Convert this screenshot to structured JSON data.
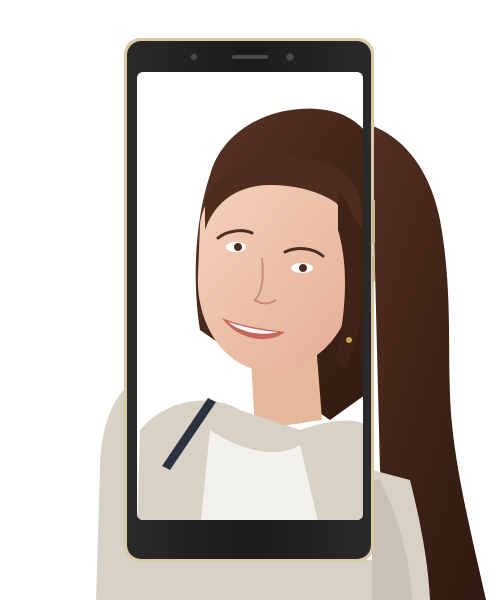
{
  "scene": {
    "subject": "product-photo-smartphone-with-woman-portrait",
    "colors": {
      "background": "#ffffff",
      "phone_body": "#1f1f20",
      "phone_frame_gold": "#d9c9a5",
      "screen_bg": "#ffffff",
      "hair": "#4a2a1d",
      "skin": "#f0c3a8",
      "cardigan": "#d8d1c6",
      "top": "#f3f1ec"
    },
    "icons": {
      "front_camera": "camera-dot",
      "sensor": "sensor-dot",
      "earpiece": "speaker-slot"
    }
  }
}
